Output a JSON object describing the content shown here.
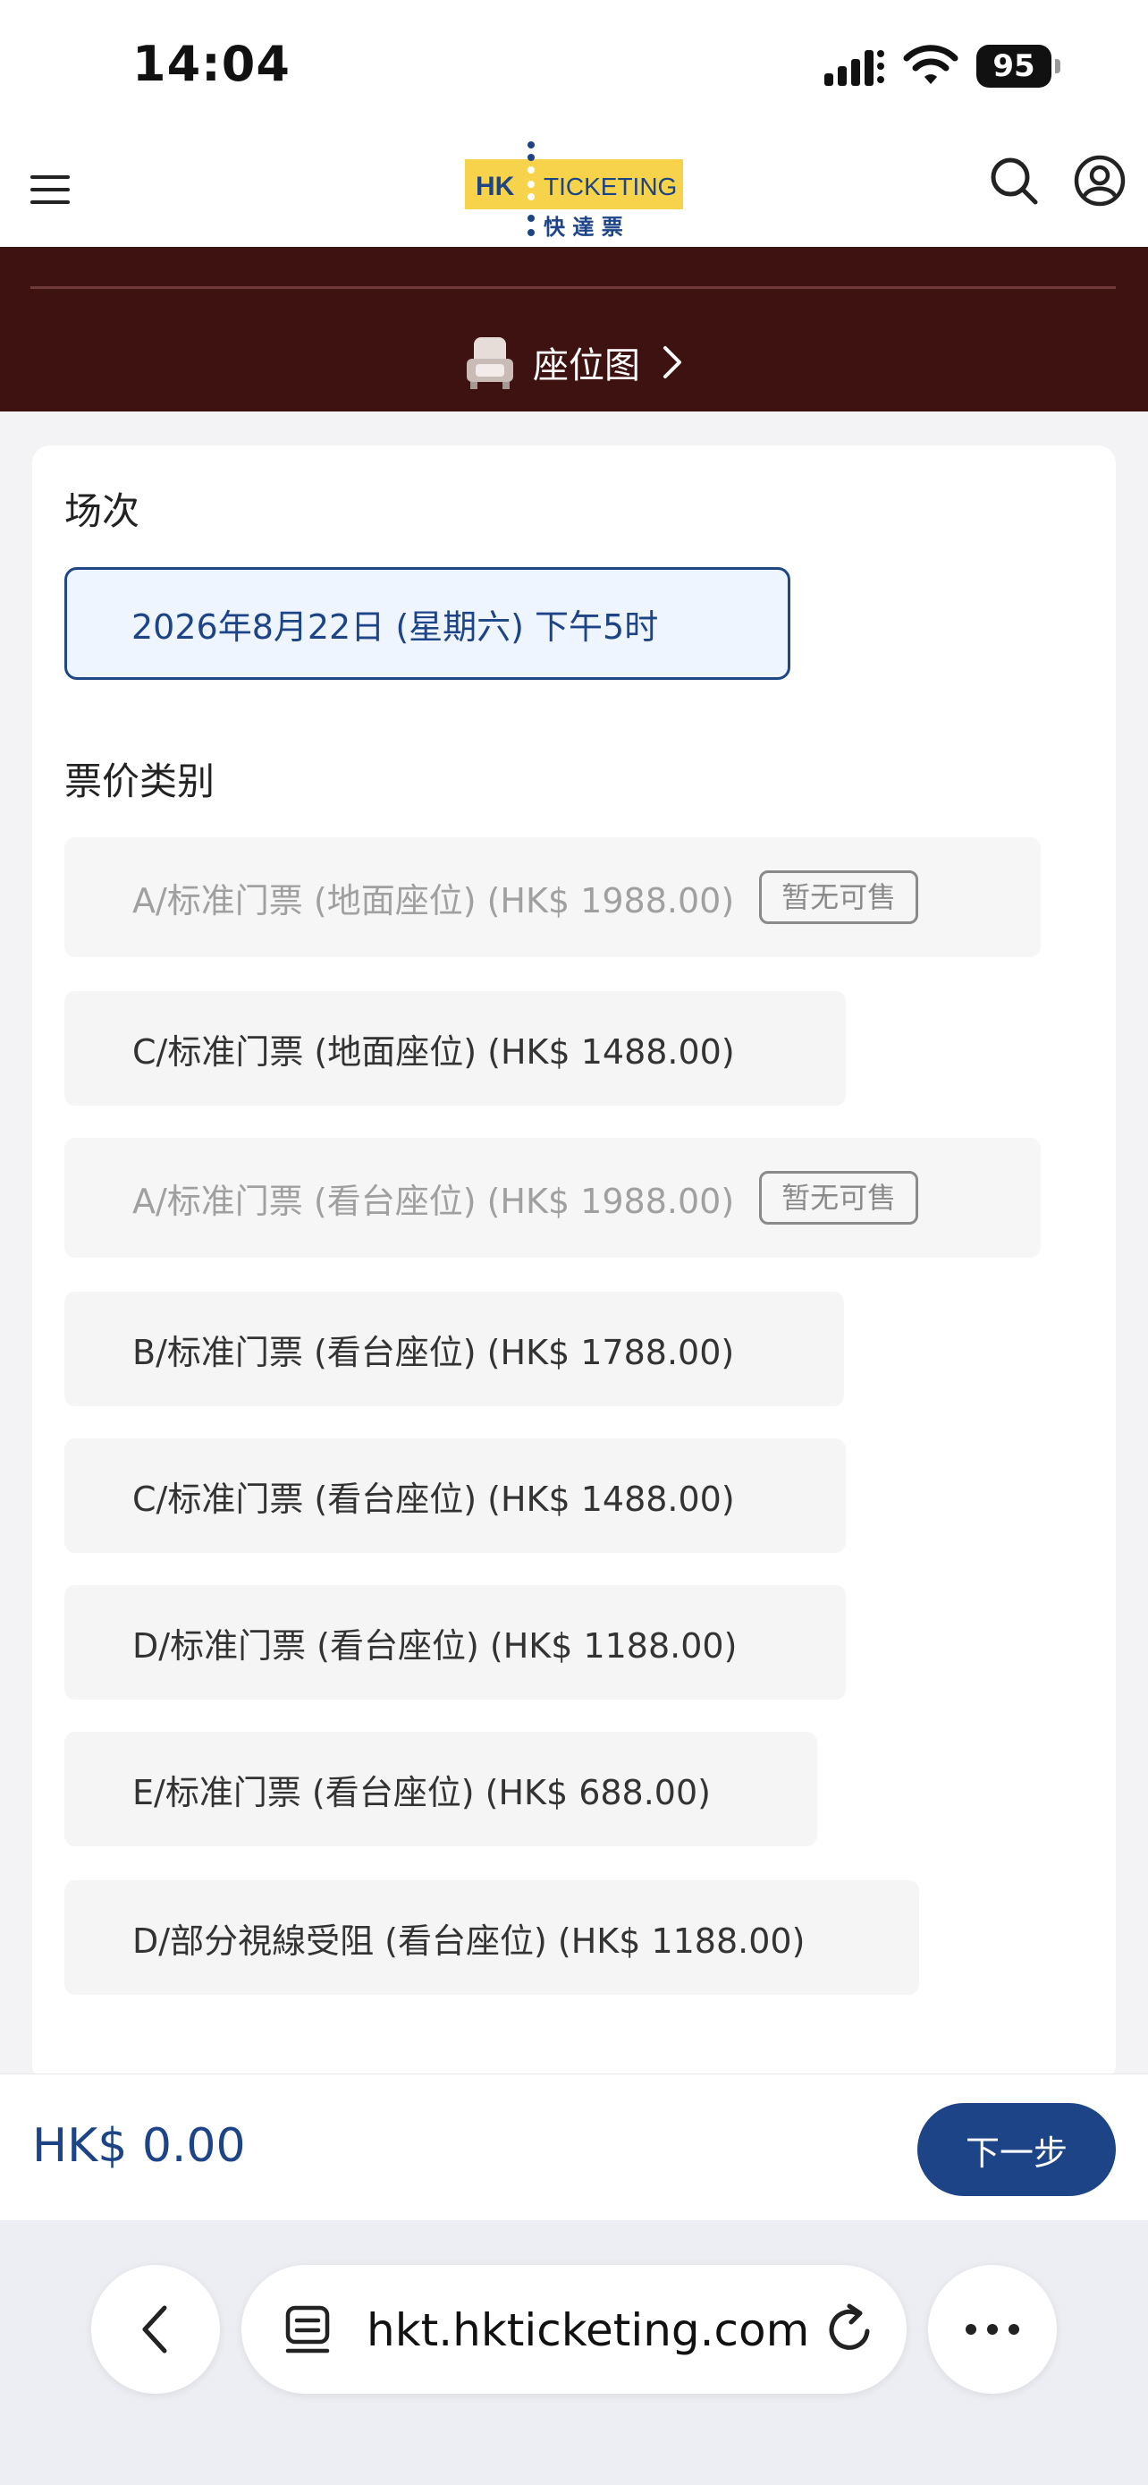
{
  "status_bar": {
    "time": "14:04",
    "battery": "95"
  },
  "header": {
    "logo_primary": "HK",
    "logo_secondary": "TICKETING",
    "logo_chinese": "快 達 票"
  },
  "seatmap": {
    "label": "座位图"
  },
  "session": {
    "title": "场次",
    "selected": "2026年8月22日 (星期六) 下午5时"
  },
  "prices": {
    "title": "票价类别",
    "items": [
      {
        "label": "A/标准门票 (地面座位) (HK$ 1988.00)",
        "badge": "暂无可售"
      },
      {
        "label": "C/标准门票 (地面座位) (HK$ 1488.00)"
      },
      {
        "label": "A/标准门票 (看台座位) (HK$ 1988.00)",
        "badge": "暂无可售"
      },
      {
        "label": "B/标准门票 (看台座位) (HK$ 1788.00)"
      },
      {
        "label": "C/标准门票 (看台座位) (HK$ 1488.00)"
      },
      {
        "label": "D/标准门票 (看台座位) (HK$ 1188.00)"
      },
      {
        "label": "E/标准门票 (看台座位) (HK$ 688.00)"
      },
      {
        "label": "D/部分視線受阻 (看台座位) (HK$ 1188.00)"
      }
    ]
  },
  "footer": {
    "total": "HK$ 0.00",
    "next_label": "下一步"
  },
  "browser": {
    "url": "hkt.hkticketing.com"
  },
  "colors": {
    "brand_blue": "#1d4486",
    "banner_maroon": "#3f1212",
    "logo_yellow": "#f6d34a"
  }
}
